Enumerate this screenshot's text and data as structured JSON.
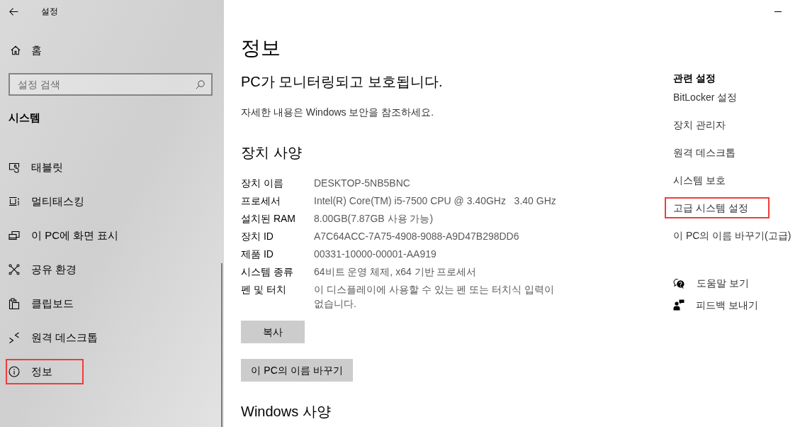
{
  "window": {
    "title": "설정"
  },
  "sidebar": {
    "home": "홈",
    "search": {
      "placeholder": "설정 검색"
    },
    "section_title": "시스템",
    "items": [
      {
        "label": "태블릿",
        "highlighted": false
      },
      {
        "label": "멀티태스킹",
        "highlighted": false
      },
      {
        "label": "이 PC에 화면 표시",
        "highlighted": false
      },
      {
        "label": "공유 환경",
        "highlighted": false
      },
      {
        "label": "클립보드",
        "highlighted": false
      },
      {
        "label": "원격 데스크톱",
        "highlighted": false
      },
      {
        "label": "정보",
        "highlighted": true
      }
    ]
  },
  "main": {
    "title": "정보",
    "security": {
      "heading": "PC가 모니터링되고 보호됩니다.",
      "text": "자세한 내용은 Windows 보안을 참조하세요."
    },
    "device_specs": {
      "heading": "장치 사양",
      "rows": [
        {
          "label": "장치 이름",
          "value": "DESKTOP-5NB5BNC"
        },
        {
          "label": "프로세서",
          "value": "Intel(R) Core(TM) i5-7500 CPU @ 3.40GHz   3.40 GHz"
        },
        {
          "label": "설치된 RAM",
          "value": "8.00GB(7.87GB 사용 가능)"
        },
        {
          "label": "장치 ID",
          "value": "A7C64ACC-7A75-4908-9088-A9D47B298DD6"
        },
        {
          "label": "제품 ID",
          "value": "00331-10000-00001-AA919"
        },
        {
          "label": "시스템 종류",
          "value": "64비트 운영 체제, x64 기반 프로세서"
        },
        {
          "label": "펜 및 터치",
          "value": "이 디스플레이에 사용할 수 있는 펜 또는 터치식 입력이 없습니다."
        }
      ],
      "buttons": [
        "복사",
        "이 PC의 이름 바꾸기"
      ]
    },
    "windows_specs": {
      "heading": "Windows 사양"
    }
  },
  "related_settings": {
    "heading": "관련 설정",
    "links": [
      {
        "label": "BitLocker 설정",
        "highlighted": false
      },
      {
        "label": "장치 관리자",
        "highlighted": false
      },
      {
        "label": "원격 데스크톱",
        "highlighted": false
      },
      {
        "label": "시스템 보호",
        "highlighted": false
      },
      {
        "label": "고급 시스템 설정",
        "highlighted": true
      },
      {
        "label": "이 PC의 이름 바꾸기(고급)",
        "highlighted": false
      }
    ]
  },
  "support_links": [
    "도움말 보기",
    "피드백 보내기"
  ]
}
